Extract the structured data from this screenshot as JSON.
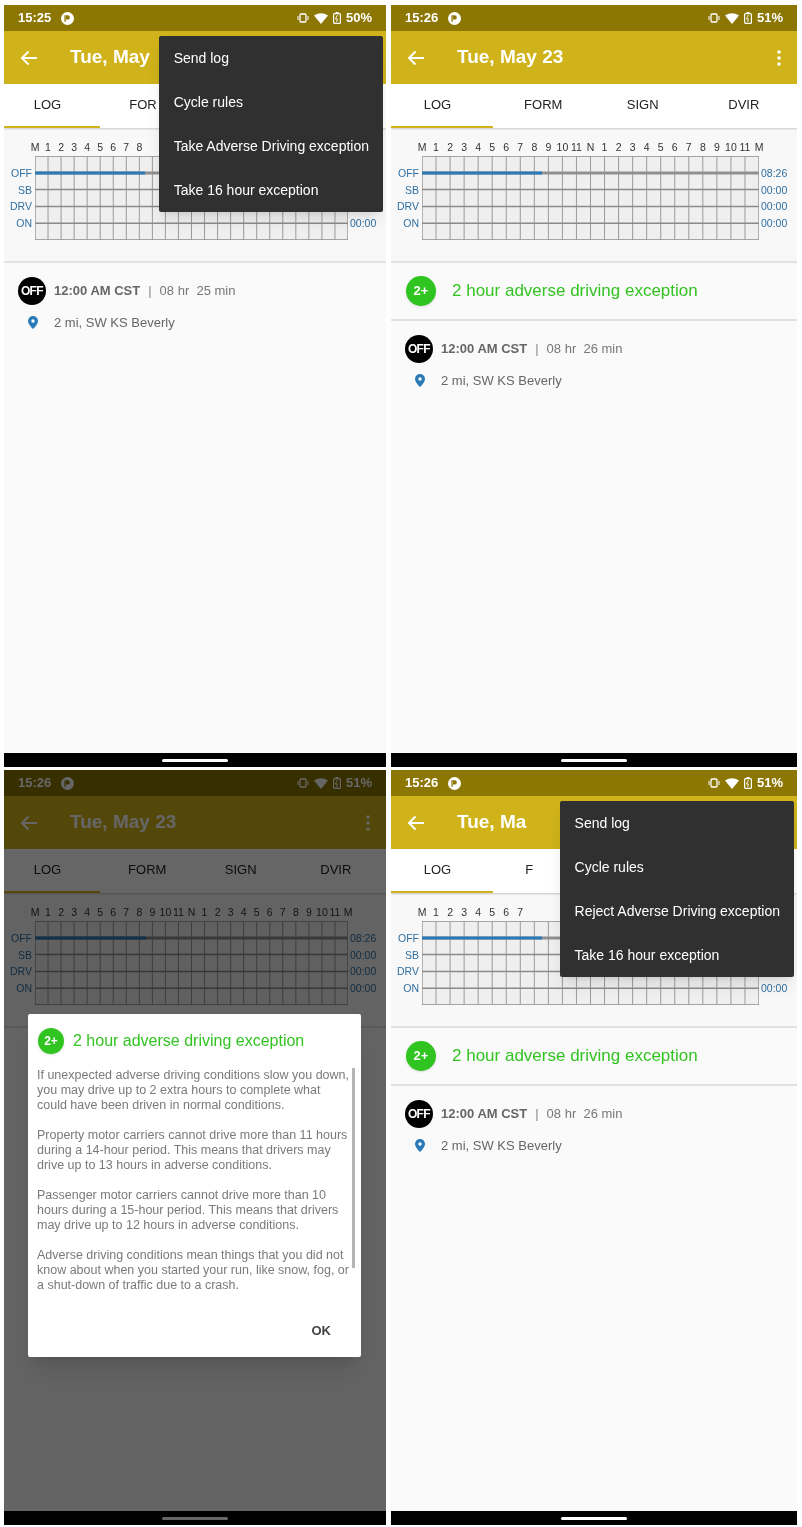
{
  "screens": [
    {
      "dimmed": false,
      "status_bar": {
        "time": "15:25",
        "battery": "50%"
      },
      "app_bar": {
        "title": "Tue, May"
      },
      "tabs": [
        {
          "label": "LOG",
          "selected": true
        },
        {
          "label": "FOR",
          "selected": false
        }
      ],
      "log_graph": {
        "hours": [
          "M",
          "1",
          "2",
          "3",
          "4",
          "5",
          "6",
          "7",
          "8"
        ],
        "rows": [
          {
            "label": "OFF",
            "level": 0.35
          },
          {
            "label": "SB"
          },
          {
            "label": "DRV"
          },
          {
            "label": "ON",
            "total": "00:00"
          }
        ]
      },
      "entries": [
        {
          "badge": "OFF",
          "time": "12:00 AM CST",
          "separator": "|",
          "duration": "08 hr  25 min",
          "location": "2 mi, SW KS Beverly"
        }
      ],
      "menu": [
        {
          "label": "Send log"
        },
        {
          "label": "Cycle rules"
        },
        {
          "label": "Take Adverse Driving exception"
        },
        {
          "label": "Take 16 hour exception"
        }
      ]
    },
    {
      "dimmed": false,
      "status_bar": {
        "time": "15:26",
        "battery": "51%"
      },
      "app_bar": {
        "title": "Tue, May 23"
      },
      "tabs": [
        {
          "label": "LOG",
          "selected": true
        },
        {
          "label": "FORM",
          "selected": false
        },
        {
          "label": "SIGN",
          "selected": false
        },
        {
          "label": "DVIR",
          "selected": false
        }
      ],
      "log_graph": {
        "hours": [
          "M",
          "1",
          "2",
          "3",
          "4",
          "5",
          "6",
          "7",
          "8",
          "9",
          "10",
          "11",
          "N",
          "1",
          "2",
          "3",
          "4",
          "5",
          "6",
          "7",
          "8",
          "9",
          "10",
          "11",
          "M"
        ],
        "rows": [
          {
            "label": "OFF",
            "total": "08:26",
            "level": 0.355
          },
          {
            "label": "SB",
            "total": "00:00"
          },
          {
            "label": "DRV",
            "total": "00:00"
          },
          {
            "label": "ON",
            "total": "00:00"
          }
        ]
      },
      "exception": {
        "badge": "2+",
        "text": "2 hour adverse driving exception"
      },
      "entries": [
        {
          "badge": "OFF",
          "time": "12:00 AM CST",
          "separator": "|",
          "duration": "08 hr  26 min",
          "location": "2 mi, SW KS Beverly"
        }
      ]
    },
    {
      "dimmed": true,
      "status_bar": {
        "time": "15:26",
        "battery": "51%"
      },
      "app_bar": {
        "title": "Tue, May 23"
      },
      "tabs": [
        {
          "label": "LOG",
          "selected": true
        },
        {
          "label": "FORM",
          "selected": false
        },
        {
          "label": "SIGN",
          "selected": false
        },
        {
          "label": "DVIR",
          "selected": false
        }
      ],
      "log_graph": {
        "hours": [
          "M",
          "1",
          "2",
          "3",
          "4",
          "5",
          "6",
          "7",
          "8",
          "9",
          "10",
          "11",
          "N",
          "1",
          "2",
          "3",
          "4",
          "5",
          "6",
          "7",
          "8",
          "9",
          "10",
          "11",
          "M"
        ],
        "rows": [
          {
            "label": "OFF",
            "total": "08:26",
            "level": 0.355
          },
          {
            "label": "SB",
            "total": "00:00"
          },
          {
            "label": "DRV",
            "total": "00:00"
          },
          {
            "label": "ON",
            "total": "00:00"
          }
        ]
      },
      "dialog": {
        "badge": "2+",
        "title": "2 hour adverse driving exception",
        "paragraphs": [
          "If unexpected adverse driving conditions slow you down, you may drive up to 2 extra hours to complete what could have been driven in normal conditions.",
          "Property motor carriers cannot drive more than 11 hours during a 14-hour period. This means that drivers may drive up to 13 hours in adverse conditions.",
          "Passenger motor carriers cannot drive more than 10 hours during a 15-hour period. This means that drivers may drive up to 12 hours in adverse conditions.",
          "Adverse driving conditions mean things that you did not know about when you started your run, like snow, fog, or a shut-down of traffic due to a crash."
        ],
        "button": "OK"
      }
    },
    {
      "dimmed": false,
      "status_bar": {
        "time": "15:26",
        "battery": "51%"
      },
      "app_bar": {
        "title": "Tue, Ma"
      },
      "tabs": [
        {
          "label": "LOG",
          "selected": true
        },
        {
          "label": "F",
          "selected": false
        }
      ],
      "log_graph": {
        "hours": [
          "M",
          "1",
          "2",
          "3",
          "4",
          "5",
          "6",
          "7"
        ],
        "rows": [
          {
            "label": "OFF",
            "level": 0.355
          },
          {
            "label": "SB"
          },
          {
            "label": "DRV"
          },
          {
            "label": "ON",
            "total": "00:00"
          }
        ]
      },
      "exception": {
        "badge": "2+",
        "text": "2 hour adverse driving exception"
      },
      "entries": [
        {
          "badge": "OFF",
          "time": "12:00 AM CST",
          "separator": "|",
          "duration": "08 hr  26 min",
          "location": "2 mi, SW KS Beverly"
        }
      ],
      "menu": [
        {
          "label": "Send log"
        },
        {
          "label": "Cycle rules"
        },
        {
          "label": "Reject Adverse Driving exception"
        },
        {
          "label": "Take 16 hour exception"
        }
      ]
    }
  ]
}
